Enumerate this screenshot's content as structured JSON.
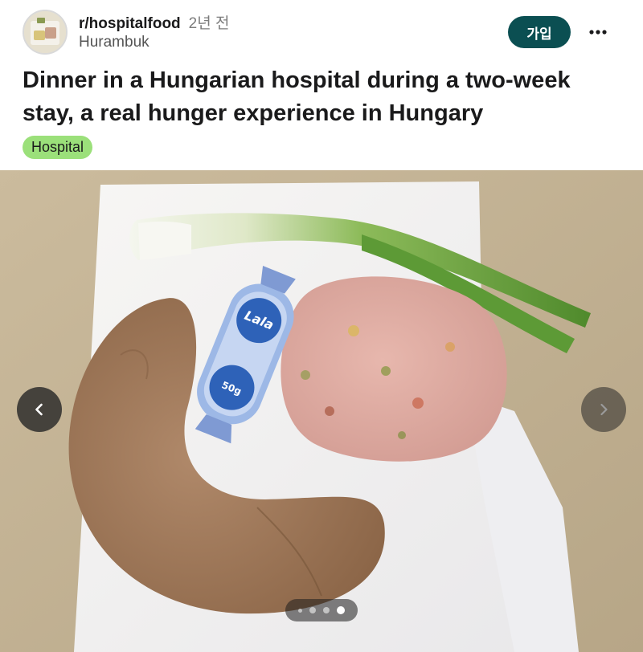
{
  "post": {
    "subreddit": "r/hospitalfood",
    "time_ago": "2년 전",
    "author": "Hurambuk",
    "join_label": "가입",
    "more_icon": "more-horizontal-icon",
    "title": "Dinner in a Hungarian hospital during a two-week stay, a real hunger experience in Hungary",
    "flair": "Hospital",
    "flair_color": "#9be07a",
    "accent_color": "#0b4f52"
  },
  "gallery": {
    "prev_icon": "chevron-left-icon",
    "next_icon": "chevron-right-icon",
    "total_images": 4,
    "current_index": 4,
    "package_text_main": "Lala",
    "package_text_weight": "50g"
  }
}
